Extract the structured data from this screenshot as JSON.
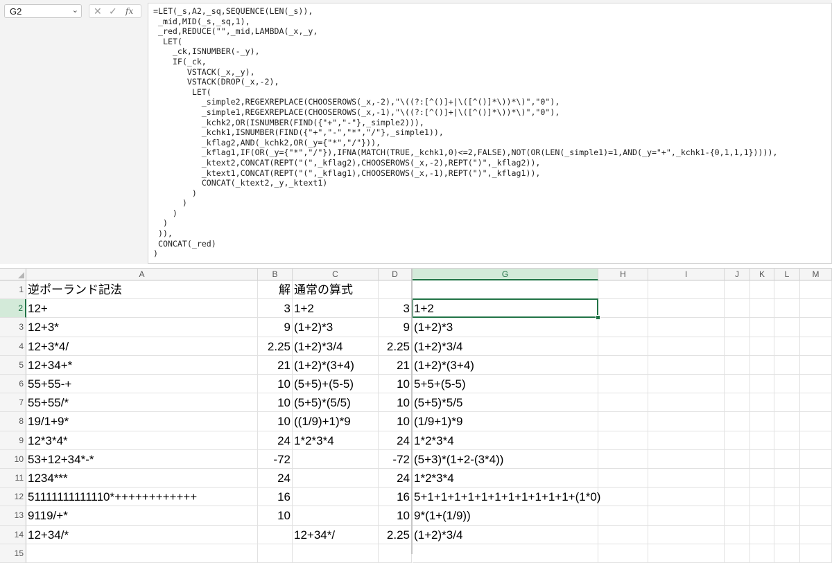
{
  "name_box": {
    "value": "G2"
  },
  "formula_tools": {
    "cancel_glyph": "✕",
    "enter_glyph": "✓",
    "fx_glyph": "fx"
  },
  "formula": "=LET(_s,A2,_sq,SEQUENCE(LEN(_s)),\n _mid,MID(_s,_sq,1),\n _red,REDUCE(\"\",_mid,LAMBDA(_x,_y,\n  LET(\n    _ck,ISNUMBER(-_y),\n    IF(_ck,\n       VSTACK(_x,_y),\n       VSTACK(DROP(_x,-2),\n        LET(\n          _simple2,REGEXREPLACE(CHOOSEROWS(_x,-2),\"\\((?:[^()]+|\\([^()]*\\))*\\)\",\"0\"),\n          _simple1,REGEXREPLACE(CHOOSEROWS(_x,-1),\"\\((?:[^()]+|\\([^()]*\\))*\\)\",\"0\"),\n          _kchk2,OR(ISNUMBER(FIND({\"+\",\"-\"},_simple2))),\n          _kchk1,ISNUMBER(FIND({\"+\",\"-\",\"*\",\"/\"},_simple1)),\n          _kflag2,AND(_kchk2,OR(_y={\"*\",\"/\"})),\n          _kflag1,IF(OR(_y={\"*\",\"/\"}),IFNA(MATCH(TRUE,_kchk1,0)<=2,FALSE),NOT(OR(LEN(_simple1)=1,AND(_y=\"+\",_kchk1-{0,1,1,1})))),\n          _ktext2,CONCAT(REPT(\"(\",_kflag2),CHOOSEROWS(_x,-2),REPT(\")\",_kflag2)),\n          _ktext1,CONCAT(REPT(\"(\",_kflag1),CHOOSEROWS(_x,-1),REPT(\")\",_kflag1)),\n          CONCAT(_ktext2,_y,_ktext1)\n        )\n      )\n    )\n  )\n )),\n CONCAT(_red)\n)",
  "columns": [
    "A",
    "B",
    "C",
    "D",
    "G",
    "H",
    "I",
    "J",
    "K",
    "L",
    "M"
  ],
  "selected_column": "G",
  "selected_row": "2",
  "rows": [
    {
      "n": "1",
      "A": "逆ポーランド記法",
      "B": "解",
      "C": "通常の算式",
      "D": "",
      "G": ""
    },
    {
      "n": "2",
      "A": "12+",
      "B": "3",
      "C": "1+2",
      "D": "3",
      "G": "1+2"
    },
    {
      "n": "3",
      "A": "12+3*",
      "B": "9",
      "C": "(1+2)*3",
      "D": "9",
      "G": "(1+2)*3"
    },
    {
      "n": "4",
      "A": "12+3*4/",
      "B": "2.25",
      "C": "(1+2)*3/4",
      "D": "2.25",
      "G": "(1+2)*3/4"
    },
    {
      "n": "5",
      "A": "12+34+*",
      "B": "21",
      "C": "(1+2)*(3+4)",
      "D": "21",
      "G": "(1+2)*(3+4)"
    },
    {
      "n": "6",
      "A": "55+55-+",
      "B": "10",
      "C": "(5+5)+(5-5)",
      "D": "10",
      "G": "5+5+(5-5)"
    },
    {
      "n": "7",
      "A": "55+55/*",
      "B": "10",
      "C": "(5+5)*(5/5)",
      "D": "10",
      "G": "(5+5)*5/5"
    },
    {
      "n": "8",
      "A": "19/1+9*",
      "B": "10",
      "C": "((1/9)+1)*9",
      "D": "10",
      "G": "(1/9+1)*9"
    },
    {
      "n": "9",
      "A": "12*3*4*",
      "B": "24",
      "C": "1*2*3*4",
      "D": "24",
      "G": "1*2*3*4"
    },
    {
      "n": "10",
      "A": "53+12+34*-*",
      "B": "-72",
      "C": "",
      "D": "-72",
      "G": "(5+3)*(1+2-(3*4))"
    },
    {
      "n": "11",
      "A": "1234***",
      "B": "24",
      "C": "",
      "D": "24",
      "G": "1*2*3*4"
    },
    {
      "n": "12",
      "A": "51111111111110*++++++++++++",
      "B": "16",
      "C": "",
      "D": "16",
      "G": "5+1+1+1+1+1+1+1+1+1+1+1+(1*0)"
    },
    {
      "n": "13",
      "A": "9119/+*",
      "B": "10",
      "C": "",
      "D": "10",
      "G": "9*(1+(1/9))"
    },
    {
      "n": "14",
      "A": "12+34/*",
      "B": "",
      "C": "12+34*/",
      "D": "2.25",
      "G": "(1+2)*3/4"
    },
    {
      "n": "15",
      "A": "",
      "B": "",
      "C": "",
      "D": "",
      "G": ""
    }
  ]
}
